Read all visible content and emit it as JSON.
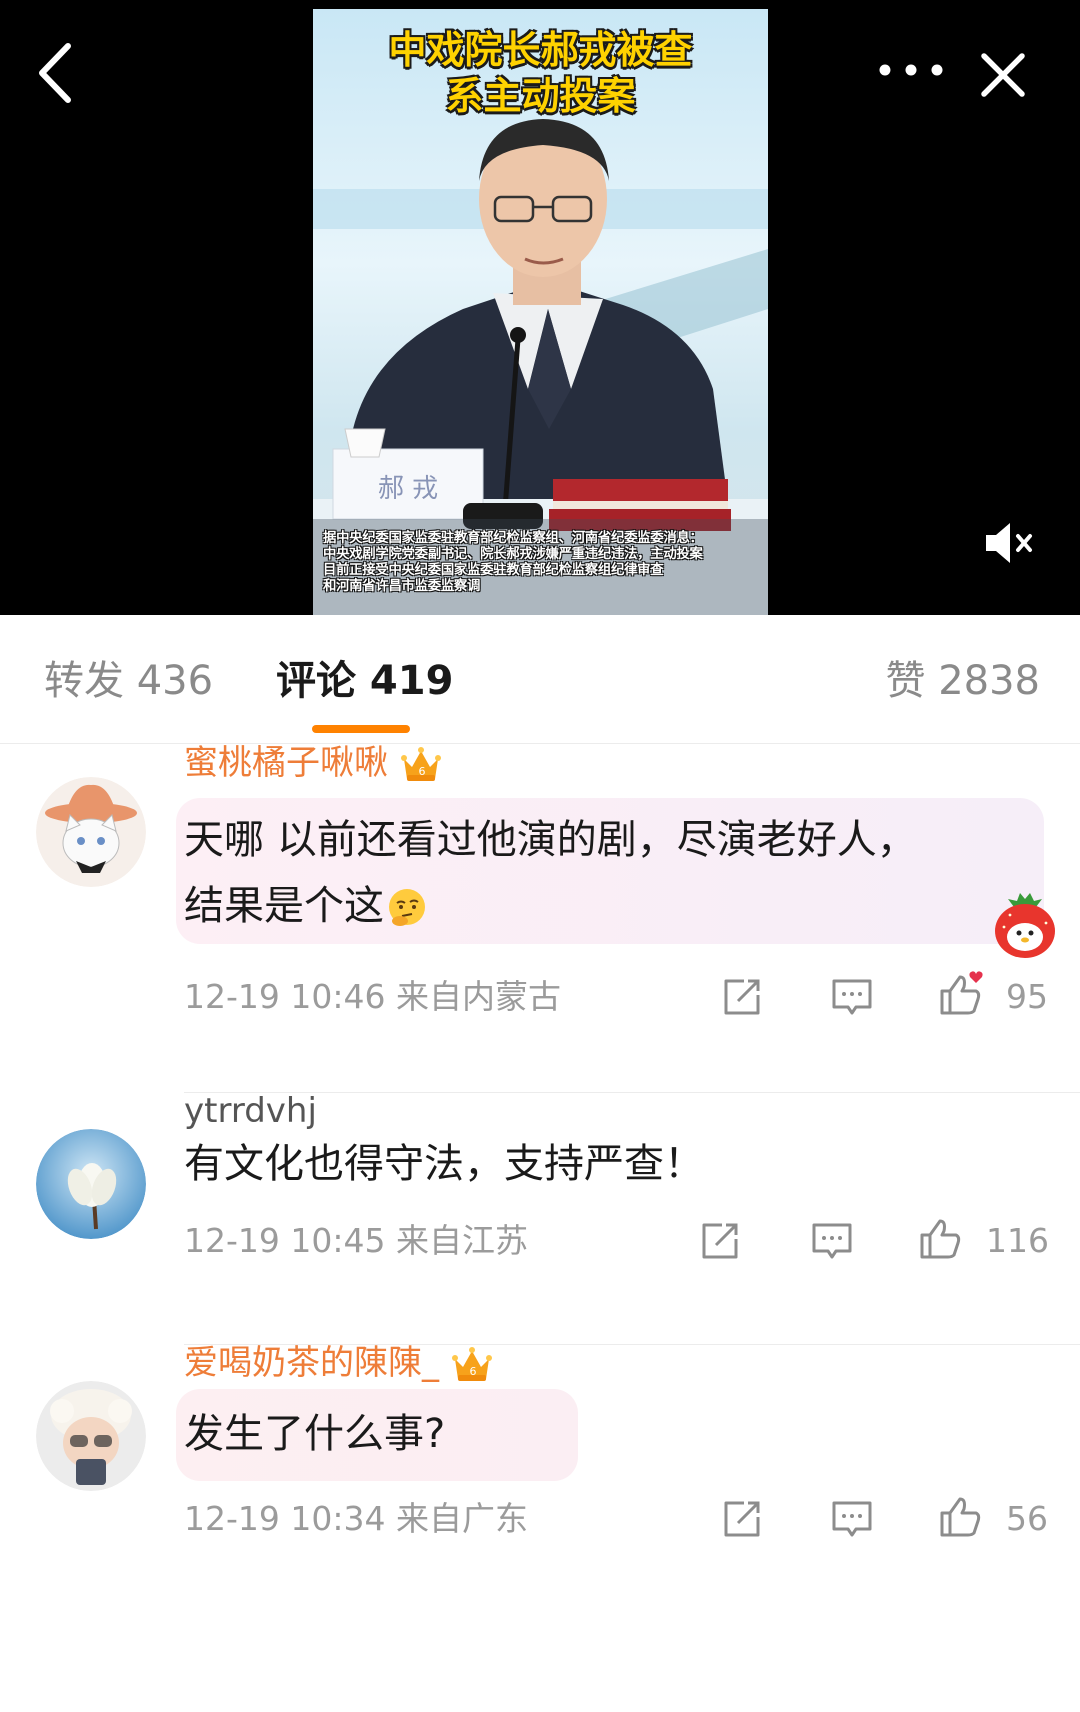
{
  "media": {
    "poster_title": "中戏院长郝戎被查\n系主动投案",
    "nameplate": "郝  戎",
    "caption": "据中央纪委国家监委驻教育部纪检监察组、河南省纪委监委消息：\n中央戏剧学院党委副书记、院长郝戎涉嫌严重违纪违法，主动投案\n目前正接受中央纪委国家监委驻教育部纪检监察组纪律审查\n和河南省许昌市监委监察调"
  },
  "tabs": {
    "repost": "转发 436",
    "comments": "评论 419",
    "likes": "赞 2838"
  },
  "comments": [
    {
      "username": "蜜桃橘子啾啾",
      "text_line1": "天哪 以前还看过他演的剧，尽演老好人，",
      "text_line2": "结果是个这",
      "time": "12-19 10:46",
      "location": "来自内蒙古",
      "likes": "95"
    },
    {
      "username": "ytrrdvhj",
      "text_line1": "有文化也得守法，支持严查！",
      "time": "12-19 10:45",
      "location": "来自江苏",
      "likes": "116"
    },
    {
      "username": "爱喝奶茶的陳陳_",
      "text_line1": "发生了什么事?",
      "time": "12-19 10:34",
      "location": "来自广东",
      "likes": "56"
    }
  ],
  "colors": {
    "accent": "#ff8200",
    "vip_name": "#ee7d38",
    "meta_gray": "#9b9b9b"
  },
  "icons": [
    "back-icon",
    "more-icon",
    "close-icon",
    "mute-icon",
    "vip-crown-icon",
    "share-icon",
    "reply-icon",
    "thumbs-up-icon"
  ]
}
